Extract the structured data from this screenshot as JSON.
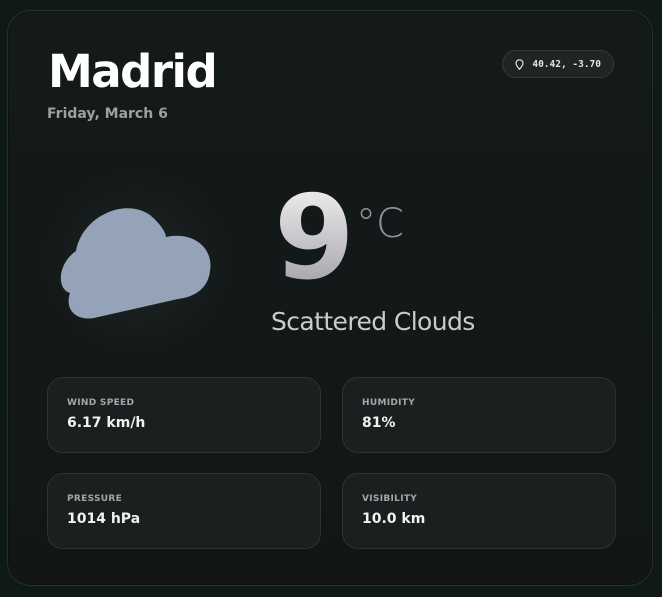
{
  "location": {
    "city": "Madrid",
    "date": "Friday, March 6",
    "coordinates": "40.42, -3.70"
  },
  "current": {
    "temperature": "9",
    "unit": "°C",
    "description": "Scattered Clouds",
    "icon": "cloud-icon"
  },
  "stats": [
    {
      "label": "WIND SPEED",
      "value": "6.17 km/h"
    },
    {
      "label": "HUMIDITY",
      "value": "81%"
    },
    {
      "label": "PRESSURE",
      "value": "1014 hPa"
    },
    {
      "label": "VISIBILITY",
      "value": "10.0 km"
    }
  ],
  "colors": {
    "background": "#0f1a17",
    "card": "#141a19",
    "cloud": "#94a3b8",
    "tile": "#1b1f20"
  }
}
